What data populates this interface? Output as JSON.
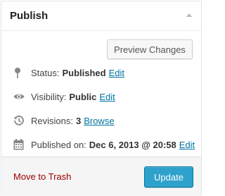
{
  "panel": {
    "title": "Publish"
  },
  "preview_button": "Preview Changes",
  "status": {
    "label": "Status:",
    "value": "Published",
    "edit": "Edit",
    "icon": "pin-icon"
  },
  "visibility": {
    "label": "Visibility:",
    "value": "Public",
    "edit": "Edit",
    "icon": "eye-icon"
  },
  "revisions": {
    "label": "Revisions:",
    "count": "3",
    "browse": "Browse",
    "icon": "history-icon"
  },
  "published_on": {
    "label": "Published on:",
    "value": "Dec 6, 2013 @ 20:58",
    "edit": "Edit",
    "icon": "calendar-icon"
  },
  "footer": {
    "trash": "Move to Trash",
    "update": "Update"
  },
  "colors": {
    "link": "#0074a2",
    "trash": "#a00000",
    "primary_button": "#2ea2cc"
  }
}
